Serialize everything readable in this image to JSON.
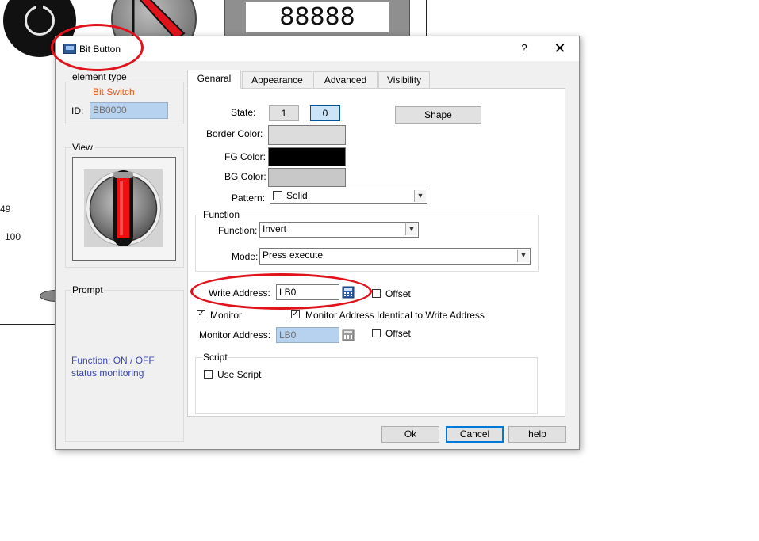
{
  "background": {
    "display_value": "88888",
    "label_49": "49",
    "label_100": "100"
  },
  "dialog": {
    "title": "Bit Button",
    "help_glyph": "?",
    "close_glyph": "✕",
    "element_type": {
      "group_label": "element type",
      "type_value": "Bit Switch",
      "id_label": "ID:",
      "id_value": "BB0000"
    },
    "view": {
      "group_label": "View"
    },
    "prompt": {
      "group_label": "Prompt",
      "text": "Function: ON / OFF status monitoring"
    },
    "tabs": [
      {
        "label": "Genaral",
        "active": true
      },
      {
        "label": "Appearance",
        "active": false
      },
      {
        "label": "Advanced",
        "active": false
      },
      {
        "label": "Visibility",
        "active": false
      }
    ],
    "general": {
      "state_label": "State:",
      "state_1": "1",
      "state_0": "0",
      "shape_button": "Shape",
      "border_color_label": "Border Color:",
      "fg_color_label": "FG Color:",
      "bg_color_label": "BG Color:",
      "pattern_label": "Pattern:",
      "pattern_value": "Solid",
      "function_group": "Function",
      "function_label": "Function:",
      "function_value": "Invert",
      "mode_label": "Mode:",
      "mode_value": "Press execute",
      "write_address_label": "Write Address:",
      "write_address_value": "LB0",
      "offset_label": "Offset",
      "monitor_label": "Monitor",
      "monitor_checked": true,
      "monitor_identical_label": "Monitor Address Identical to Write Address",
      "monitor_identical_checked": true,
      "monitor_address_label": "Monitor Address:",
      "monitor_address_value": "LB0",
      "offset2_label": "Offset",
      "script_group": "Script",
      "use_script_label": "Use Script"
    },
    "buttons": {
      "ok": "Ok",
      "cancel": "Cancel",
      "help": "help"
    },
    "colors": {
      "border_color": "#dcdcdc",
      "fg_color": "#000000",
      "bg_color": "#c8c8c8",
      "element_type_accent": "#e05a1f",
      "prompt_text": "#3c48b0",
      "annotation_red": "#e0131c"
    }
  }
}
